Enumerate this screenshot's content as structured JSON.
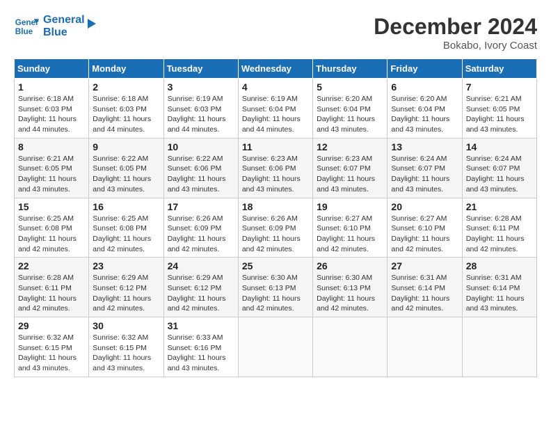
{
  "header": {
    "logo_line1": "General",
    "logo_line2": "Blue",
    "month_year": "December 2024",
    "location": "Bokabo, Ivory Coast"
  },
  "weekdays": [
    "Sunday",
    "Monday",
    "Tuesday",
    "Wednesday",
    "Thursday",
    "Friday",
    "Saturday"
  ],
  "weeks": [
    [
      {
        "day": "1",
        "sunrise": "6:18 AM",
        "sunset": "6:03 PM",
        "daylight": "11 hours and 44 minutes."
      },
      {
        "day": "2",
        "sunrise": "6:18 AM",
        "sunset": "6:03 PM",
        "daylight": "11 hours and 44 minutes."
      },
      {
        "day": "3",
        "sunrise": "6:19 AM",
        "sunset": "6:03 PM",
        "daylight": "11 hours and 44 minutes."
      },
      {
        "day": "4",
        "sunrise": "6:19 AM",
        "sunset": "6:04 PM",
        "daylight": "11 hours and 44 minutes."
      },
      {
        "day": "5",
        "sunrise": "6:20 AM",
        "sunset": "6:04 PM",
        "daylight": "11 hours and 43 minutes."
      },
      {
        "day": "6",
        "sunrise": "6:20 AM",
        "sunset": "6:04 PM",
        "daylight": "11 hours and 43 minutes."
      },
      {
        "day": "7",
        "sunrise": "6:21 AM",
        "sunset": "6:05 PM",
        "daylight": "11 hours and 43 minutes."
      }
    ],
    [
      {
        "day": "8",
        "sunrise": "6:21 AM",
        "sunset": "6:05 PM",
        "daylight": "11 hours and 43 minutes."
      },
      {
        "day": "9",
        "sunrise": "6:22 AM",
        "sunset": "6:05 PM",
        "daylight": "11 hours and 43 minutes."
      },
      {
        "day": "10",
        "sunrise": "6:22 AM",
        "sunset": "6:06 PM",
        "daylight": "11 hours and 43 minutes."
      },
      {
        "day": "11",
        "sunrise": "6:23 AM",
        "sunset": "6:06 PM",
        "daylight": "11 hours and 43 minutes."
      },
      {
        "day": "12",
        "sunrise": "6:23 AM",
        "sunset": "6:07 PM",
        "daylight": "11 hours and 43 minutes."
      },
      {
        "day": "13",
        "sunrise": "6:24 AM",
        "sunset": "6:07 PM",
        "daylight": "11 hours and 43 minutes."
      },
      {
        "day": "14",
        "sunrise": "6:24 AM",
        "sunset": "6:07 PM",
        "daylight": "11 hours and 43 minutes."
      }
    ],
    [
      {
        "day": "15",
        "sunrise": "6:25 AM",
        "sunset": "6:08 PM",
        "daylight": "11 hours and 42 minutes."
      },
      {
        "day": "16",
        "sunrise": "6:25 AM",
        "sunset": "6:08 PM",
        "daylight": "11 hours and 42 minutes."
      },
      {
        "day": "17",
        "sunrise": "6:26 AM",
        "sunset": "6:09 PM",
        "daylight": "11 hours and 42 minutes."
      },
      {
        "day": "18",
        "sunrise": "6:26 AM",
        "sunset": "6:09 PM",
        "daylight": "11 hours and 42 minutes."
      },
      {
        "day": "19",
        "sunrise": "6:27 AM",
        "sunset": "6:10 PM",
        "daylight": "11 hours and 42 minutes."
      },
      {
        "day": "20",
        "sunrise": "6:27 AM",
        "sunset": "6:10 PM",
        "daylight": "11 hours and 42 minutes."
      },
      {
        "day": "21",
        "sunrise": "6:28 AM",
        "sunset": "6:11 PM",
        "daylight": "11 hours and 42 minutes."
      }
    ],
    [
      {
        "day": "22",
        "sunrise": "6:28 AM",
        "sunset": "6:11 PM",
        "daylight": "11 hours and 42 minutes."
      },
      {
        "day": "23",
        "sunrise": "6:29 AM",
        "sunset": "6:12 PM",
        "daylight": "11 hours and 42 minutes."
      },
      {
        "day": "24",
        "sunrise": "6:29 AM",
        "sunset": "6:12 PM",
        "daylight": "11 hours and 42 minutes."
      },
      {
        "day": "25",
        "sunrise": "6:30 AM",
        "sunset": "6:13 PM",
        "daylight": "11 hours and 42 minutes."
      },
      {
        "day": "26",
        "sunrise": "6:30 AM",
        "sunset": "6:13 PM",
        "daylight": "11 hours and 42 minutes."
      },
      {
        "day": "27",
        "sunrise": "6:31 AM",
        "sunset": "6:14 PM",
        "daylight": "11 hours and 42 minutes."
      },
      {
        "day": "28",
        "sunrise": "6:31 AM",
        "sunset": "6:14 PM",
        "daylight": "11 hours and 43 minutes."
      }
    ],
    [
      {
        "day": "29",
        "sunrise": "6:32 AM",
        "sunset": "6:15 PM",
        "daylight": "11 hours and 43 minutes."
      },
      {
        "day": "30",
        "sunrise": "6:32 AM",
        "sunset": "6:15 PM",
        "daylight": "11 hours and 43 minutes."
      },
      {
        "day": "31",
        "sunrise": "6:33 AM",
        "sunset": "6:16 PM",
        "daylight": "11 hours and 43 minutes."
      },
      null,
      null,
      null,
      null
    ]
  ],
  "labels": {
    "sunrise": "Sunrise:",
    "sunset": "Sunset:",
    "daylight": "Daylight:"
  }
}
